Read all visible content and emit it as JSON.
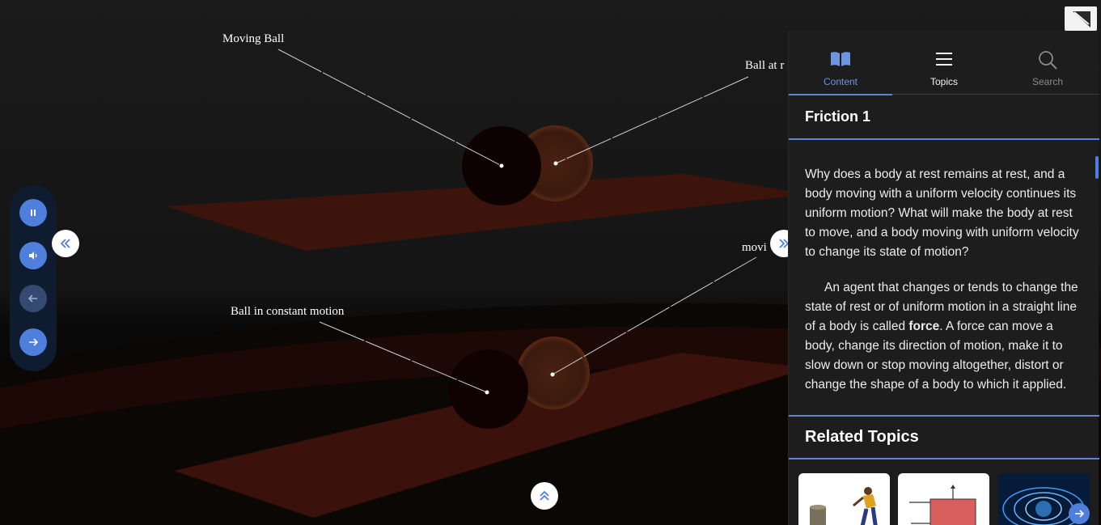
{
  "scene": {
    "labels": {
      "moving_ball": "Moving Ball",
      "ball_at_rest": "Ball at r",
      "ball_constant_motion": "Ball in constant motion",
      "moving": "movi"
    }
  },
  "controls": {
    "icons": [
      "pause-icon",
      "volume-icon",
      "arrow-left-icon",
      "arrow-right-icon"
    ],
    "accent_color": "#4f7fdc"
  },
  "panel": {
    "tabs": [
      {
        "label": "Content",
        "icon": "book-icon",
        "active": true
      },
      {
        "label": "Topics",
        "icon": "menu-icon",
        "active": false
      },
      {
        "label": "Search",
        "icon": "search-icon",
        "active": false
      }
    ],
    "title": "Friction 1",
    "paragraph1": "Why does a body at rest remains at rest, and a body moving with a uniform velocity continues its uniform motion? What will make the body at rest to move, and a body moving with uniform velocity to change its state of motion?",
    "paragraph2_before": "An agent that changes or tends to change the state of rest or of uniform motion in a straight line of a body is called ",
    "paragraph2_bold": "force",
    "paragraph2_after": ". A force can move a body, change its direction of motion, make it to slow down or stop moving altogether, distort or change the shape of a body to which it applied.",
    "related_title": "Related Topics"
  }
}
